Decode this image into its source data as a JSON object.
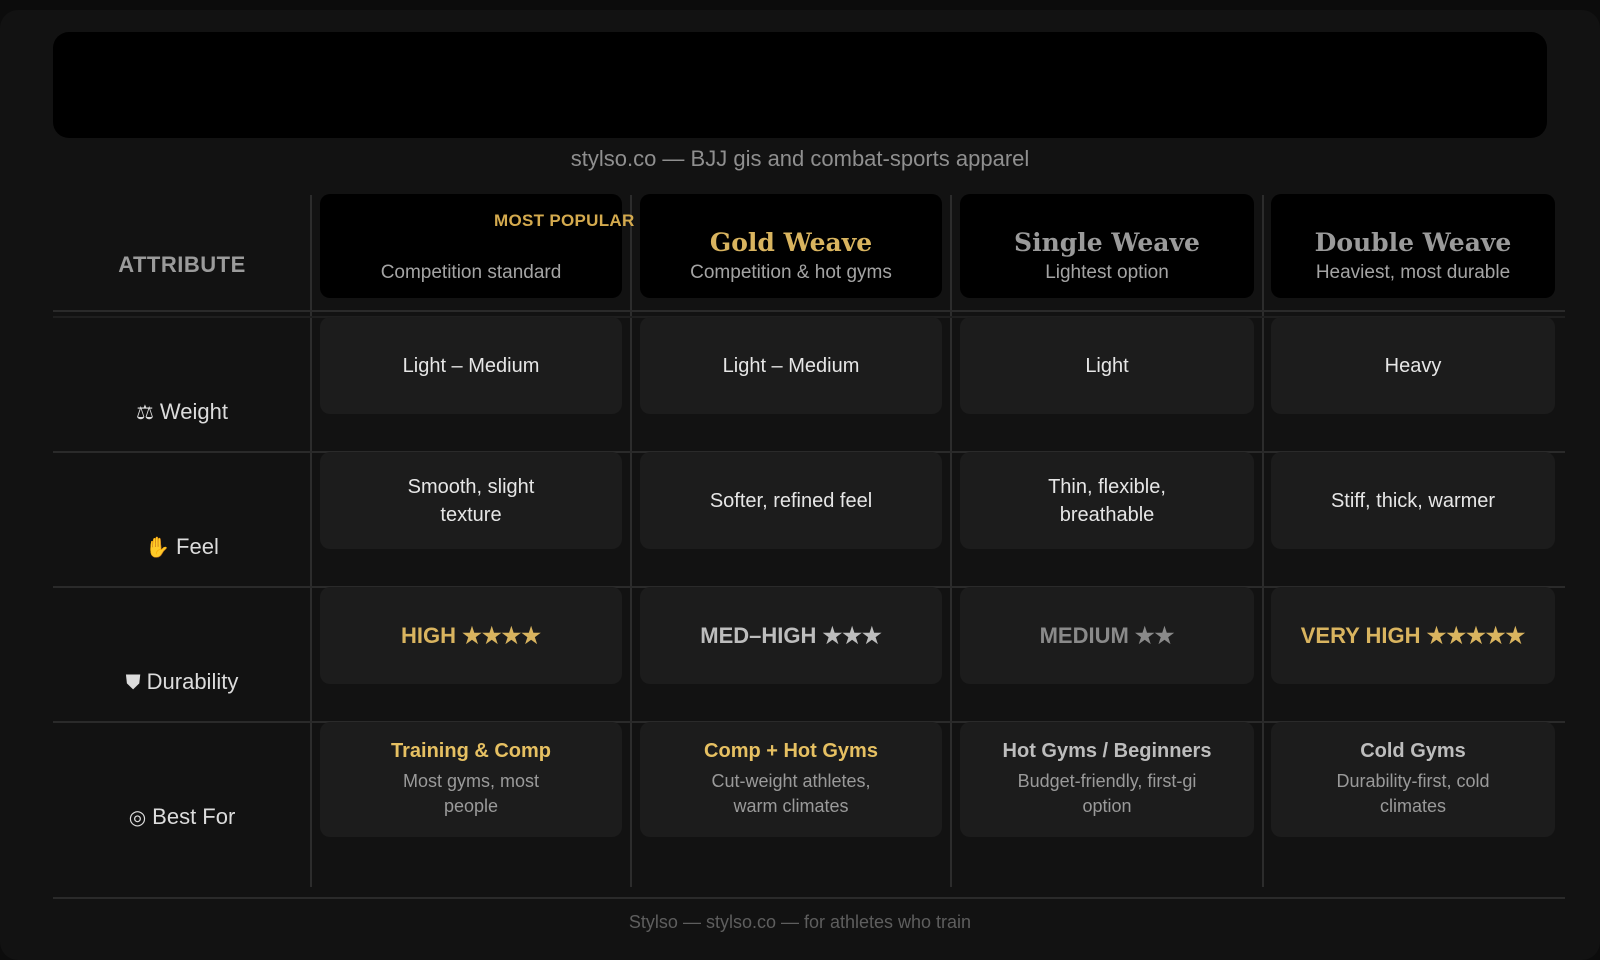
{
  "tagline": "stylso.co — BJJ gis and combat-sports apparel",
  "table": {
    "attribute_header": "ATTRIBUTE",
    "badge": "MOST POPULAR",
    "plans": [
      {
        "title": "",
        "subtitle": "Competition standard"
      },
      {
        "title": "Gold Weave",
        "subtitle": "Competition & hot gyms"
      },
      {
        "title": "Single Weave",
        "subtitle": "Lightest option"
      },
      {
        "title": "Double Weave",
        "subtitle": "Heaviest, most durable"
      }
    ],
    "rows": {
      "weight": {
        "icon": "⚖",
        "label": "Weight",
        "values": [
          "Light – Medium",
          "Light – Medium",
          "Light",
          "Heavy"
        ]
      },
      "feel": {
        "icon": "✋",
        "label": "Feel",
        "values": [
          "Smooth, slight texture",
          "Softer, refined feel",
          "Thin, flexible, breathable",
          "Stiff, thick, warmer"
        ]
      },
      "durability": {
        "icon": "⛊",
        "label": "Durability",
        "values": [
          "HIGH ★★★★",
          "MED–HIGH ★★★",
          "MEDIUM ★★",
          "VERY HIGH ★★★★★"
        ]
      },
      "best_for": {
        "icon": "◎",
        "label": "Best For",
        "items": [
          {
            "title": "Training & Comp",
            "sub": "Most gyms, most people"
          },
          {
            "title": "Comp + Hot Gyms",
            "sub": "Cut-weight athletes, warm climates"
          },
          {
            "title": "Hot Gyms / Beginners",
            "sub": "Budget-friendly, first-gi option"
          },
          {
            "title": "Cold Gyms",
            "sub": "Durability-first, cold climates"
          }
        ]
      }
    }
  },
  "colors": {
    "gold": "#d9b45f",
    "gold_bright": "#e6c062",
    "silver": "#bdbdbd",
    "grey": "#8a8a8a"
  },
  "footer": "Stylso — stylso.co — for athletes who train"
}
